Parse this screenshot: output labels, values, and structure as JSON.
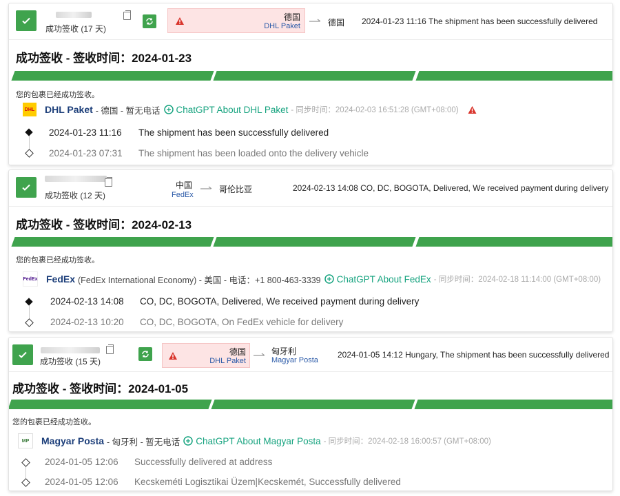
{
  "shipments": [
    {
      "status_short": "成功签收 (17 天)",
      "origin_country": "德国",
      "origin_carrier": "DHL Paket",
      "dest_country": "德国",
      "latest_event": "2024-01-23 11:16  The shipment has been successfully delivered",
      "title": "成功签收 - 签收时间：2024-01-23",
      "notice": "您的包裹已经成功签收。",
      "carrier_name": "DHL Paket",
      "carrier_meta": "- 德国 - 暂无电话",
      "chatgpt_link": "ChatGPT About DHL Paket",
      "sync_text": "- 同步时间：2024-02-03 16:51:28 (GMT+08:00)",
      "events": [
        {
          "time": "2024-01-23 11:16",
          "desc": "The shipment has been successfully delivered"
        },
        {
          "time": "2024-01-23 07:31",
          "desc": "The shipment has been loaded onto the delivery vehicle"
        }
      ]
    },
    {
      "status_short": "成功签收 (12 天)",
      "origin_country": "中国",
      "origin_carrier": "FedEx",
      "dest_country": "哥伦比亚",
      "latest_event": "2024-02-13 14:08  CO, DC, BOGOTA, Delivered, We received payment during delivery",
      "title": "成功签收 - 签收时间：2024-02-13",
      "notice": "您的包裹已经成功签收。",
      "carrier_name": "FedEx",
      "carrier_meta": "(FedEx International Economy) - 美国 - 电话：+1 800-463-3339",
      "chatgpt_link": "ChatGPT About FedEx",
      "sync_text": "- 同步时间：2024-02-18 11:14:00 (GMT+08:00)",
      "events": [
        {
          "time": "2024-02-13 14:08",
          "desc": "CO, DC, BOGOTA, Delivered, We received payment during delivery"
        },
        {
          "time": "2024-02-13 10:20",
          "desc": "CO, DC, BOGOTA, On FedEx vehicle for delivery"
        }
      ]
    },
    {
      "status_short": "成功签收 (15 天)",
      "origin_country": "德国",
      "origin_carrier": "DHL Paket",
      "dest_country": "匈牙利",
      "dest_carrier": "Magyar Posta",
      "latest_event": "2024-01-05 14:12  Hungary, The shipment has been successfully delivered",
      "title": "成功签收 - 签收时间：2024-01-05",
      "notice": "您的包裹已经成功签收。",
      "carrier_name": "Magyar Posta",
      "carrier_meta": "- 匈牙利 - 暂无电话",
      "chatgpt_link": "ChatGPT About Magyar Posta",
      "sync_text": "- 同步时间：2024-02-18 16:00:57 (GMT+08:00)",
      "events": [
        {
          "time": "2024-01-05 12:06",
          "desc": "Successfully delivered at address"
        },
        {
          "time": "2024-01-05 12:06",
          "desc": "Kecskeméti Logisztikai Üzem|Kecskemét, Successfully delivered"
        }
      ]
    }
  ],
  "colors": {
    "success": "#3fa34d",
    "warning": "#d9342b",
    "link": "#1d3f7a",
    "chatgpt": "#16a37f"
  },
  "icons": [
    "check-icon",
    "copy-icon",
    "sync-icon",
    "warning-icon",
    "arrow-right-icon",
    "chatgpt-icon",
    "dhl-logo",
    "fedex-logo",
    "magyar-posta-logo",
    "timeline-dot-icon"
  ]
}
